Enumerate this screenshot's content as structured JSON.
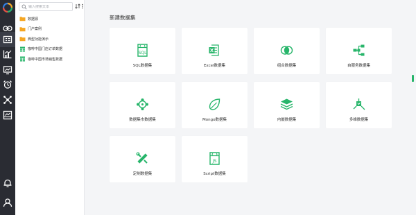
{
  "search": {
    "placeholder": "输入搜索文本"
  },
  "icons": {
    "rail": [
      "logo-icon",
      "link-icon",
      "dataset-icon",
      "chart-icon",
      "dashboard-icon",
      "alarm-clock-icon",
      "network-icon",
      "screen-icon",
      "bell-icon",
      "user-icon"
    ],
    "toolbar": [
      "sort-icon",
      "more-icon"
    ]
  },
  "colors": {
    "accent": "#27b56a",
    "rail": "#2a2c33",
    "folder": "#f5a623",
    "table": "#27b56a"
  },
  "tree": {
    "items": [
      {
        "label": "数据源",
        "icon": "folder-icon"
      },
      {
        "label": "门户案例",
        "icon": "folder-icon"
      },
      {
        "label": "典型功能演示",
        "icon": "folder-icon"
      },
      {
        "label": "咖啡中国门店订单数据",
        "icon": "table-icon"
      },
      {
        "label": "咖啡中国市场销售数据",
        "icon": "table-icon"
      }
    ]
  },
  "main": {
    "title": "新建数据集",
    "cards": [
      {
        "label": "SQL数据集",
        "icon": "sql-icon"
      },
      {
        "label": "Excel数据集",
        "icon": "excel-icon"
      },
      {
        "label": "组合数据集",
        "icon": "combine-icon"
      },
      {
        "label": "自服务数据集",
        "icon": "self-service-icon"
      },
      {
        "label": "数据集市数据集",
        "icon": "data-mart-icon"
      },
      {
        "label": "Mongo数据集",
        "icon": "mongo-leaf-icon"
      },
      {
        "label": "内嵌数据集",
        "icon": "layers-icon"
      },
      {
        "label": "多维数据集",
        "icon": "multidim-icon"
      },
      {
        "label": "定制数据集",
        "icon": "custom-tools-icon"
      },
      {
        "label": "Script数据集",
        "icon": "script-js-icon"
      }
    ]
  }
}
